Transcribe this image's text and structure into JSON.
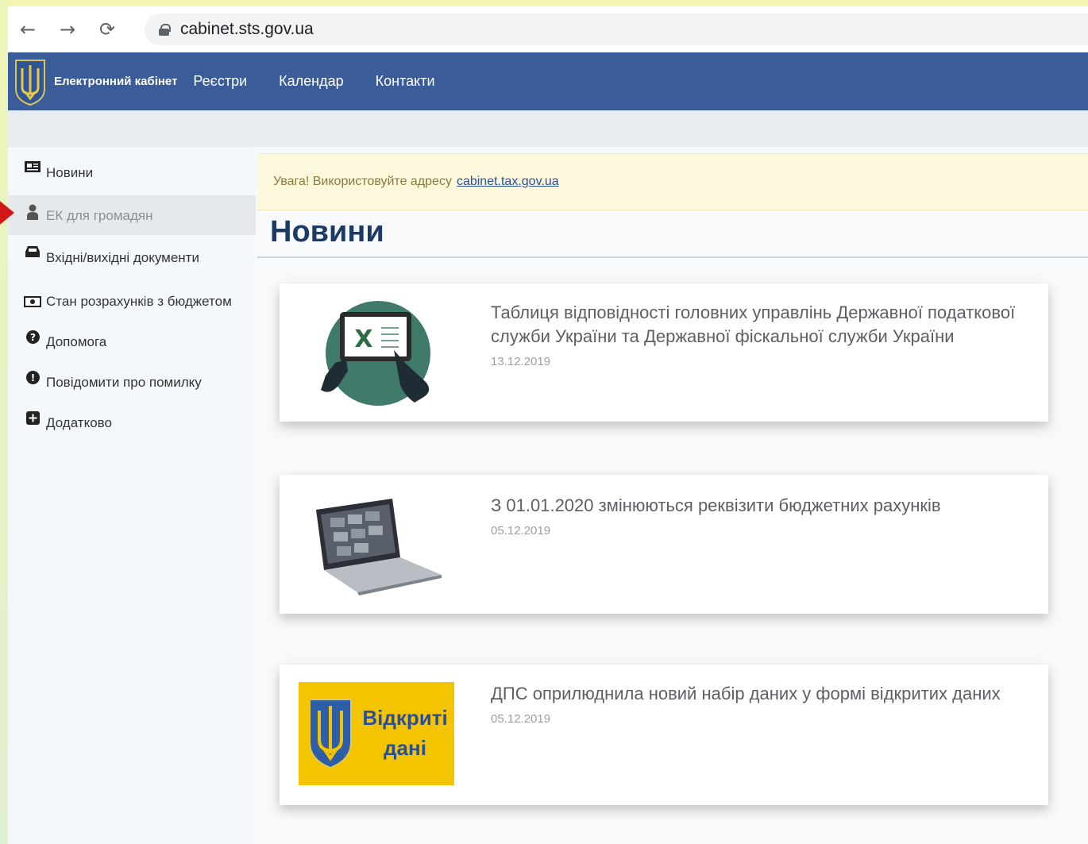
{
  "browser": {
    "back_icon": "←",
    "forward_icon": "→",
    "reload_icon": "⟳",
    "url": "cabinet.sts.gov.ua"
  },
  "header": {
    "brand": "Електронний кабінет",
    "nav": [
      "Реєстри",
      "Календар",
      "Контакти"
    ],
    "color": "#3a5d99"
  },
  "sidebar": {
    "items": [
      {
        "label": "Новини",
        "icon": "newspaper-icon"
      },
      {
        "label": "ЕК для громадян",
        "icon": "user-icon",
        "active": true
      },
      {
        "label": "Вхідні/вихідні документи",
        "icon": "inbox-icon"
      },
      {
        "label": "Стан розрахунків з бюджетом",
        "icon": "money-icon"
      },
      {
        "label": "Допомога",
        "icon": "question-circle-icon"
      },
      {
        "label": "Повідомити про помилку",
        "icon": "exclamation-circle-icon"
      },
      {
        "label": "Додатково",
        "icon": "plus-square-icon"
      }
    ]
  },
  "notice": {
    "text": "Увага! Використовуйте адресу",
    "link": "cabinet.tax.gov.ua"
  },
  "page_title": "Новини",
  "news": [
    {
      "title": "Таблиця відповідності головних управлінь Державної податкової служби України та Державної фіскальної служби України",
      "date": "13.12.2019"
    },
    {
      "title": "З 01.01.2020 змінюються реквізити бюджетних рахунків",
      "date": "05.12.2019"
    },
    {
      "title": "ДПС оприлюднила новий набір даних у формі відкритих даних",
      "date": "05.12.2019",
      "image_text": [
        "Відкриті",
        "дані"
      ]
    }
  ]
}
